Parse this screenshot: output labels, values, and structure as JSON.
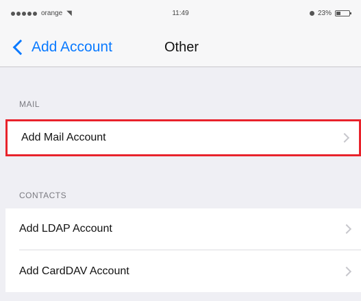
{
  "status_bar": {
    "carrier": "orange",
    "time": "11:49",
    "battery_text": "23%",
    "icons": [
      "signal-dots-icon",
      "wifi-icon",
      "lock-icon",
      "battery-icon"
    ]
  },
  "nav": {
    "back_label": "Add Account",
    "title": "Other",
    "accent_color": "#0a7aff"
  },
  "sections": {
    "mail": {
      "header": "MAIL",
      "items": [
        {
          "label": "Add Mail Account",
          "highlighted": true
        }
      ]
    },
    "contacts": {
      "header": "CONTACTS",
      "items": [
        {
          "label": "Add LDAP Account"
        },
        {
          "label": "Add CardDAV Account"
        }
      ]
    }
  },
  "highlight_color": "#e8222b"
}
